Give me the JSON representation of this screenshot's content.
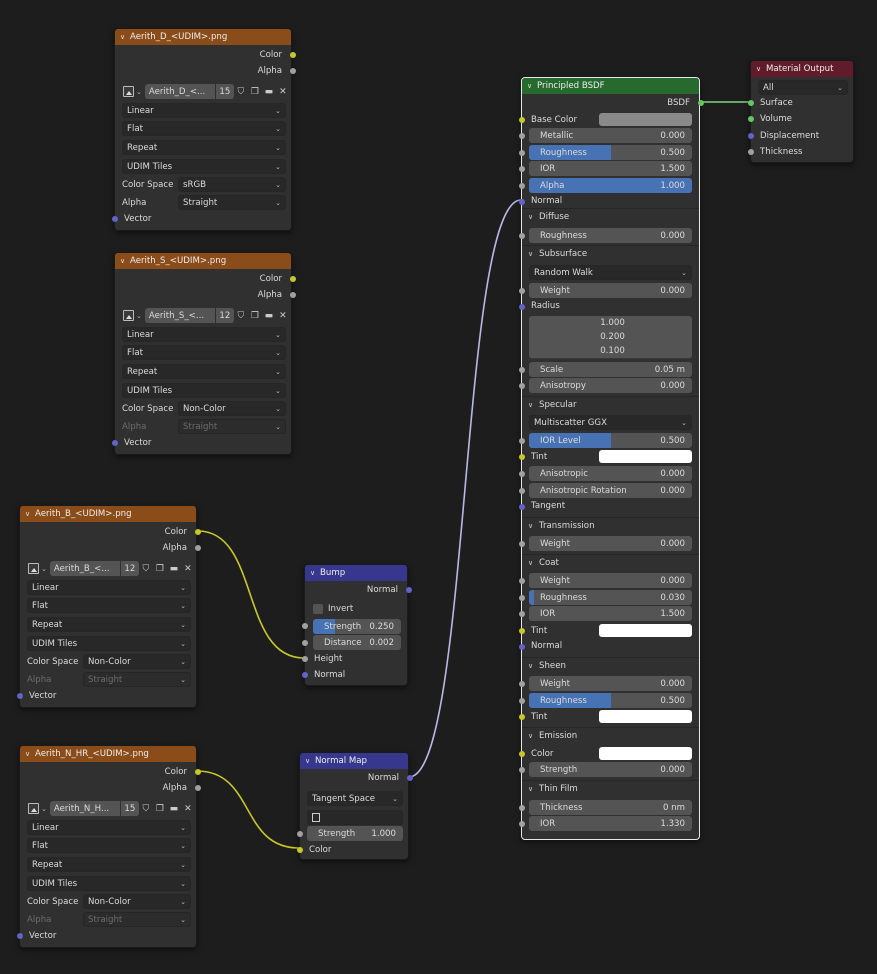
{
  "textures": [
    {
      "title": "Aerith_D_<UDIM>.png",
      "color": "Color",
      "alpha": "Alpha",
      "image_name": "Aerith_D_<...",
      "tile_count": "15",
      "interpolation": "Linear",
      "projection": "Flat",
      "extension": "Repeat",
      "source": "UDIM Tiles",
      "color_space_label": "Color Space",
      "color_space": "sRGB",
      "alpha_label": "Alpha",
      "alpha_mode": "Straight",
      "vector": "Vector"
    },
    {
      "title": "Aerith_S_<UDIM>.png",
      "color": "Color",
      "alpha": "Alpha",
      "image_name": "Aerith_S_<...",
      "tile_count": "12",
      "interpolation": "Linear",
      "projection": "Flat",
      "extension": "Repeat",
      "source": "UDIM Tiles",
      "color_space_label": "Color Space",
      "color_space": "Non-Color",
      "alpha_label": "Alpha",
      "alpha_mode": "Straight",
      "vector": "Vector"
    },
    {
      "title": "Aerith_B_<UDIM>.png",
      "color": "Color",
      "alpha": "Alpha",
      "image_name": "Aerith_B_<...",
      "tile_count": "12",
      "interpolation": "Linear",
      "projection": "Flat",
      "extension": "Repeat",
      "source": "UDIM Tiles",
      "color_space_label": "Color Space",
      "color_space": "Non-Color",
      "alpha_label": "Alpha",
      "alpha_mode": "Straight",
      "vector": "Vector"
    },
    {
      "title": "Aerith_N_HR_<UDIM>.png",
      "color": "Color",
      "alpha": "Alpha",
      "image_name": "Aerith_N_H...",
      "tile_count": "15",
      "interpolation": "Linear",
      "projection": "Flat",
      "extension": "Repeat",
      "source": "UDIM Tiles",
      "color_space_label": "Color Space",
      "color_space": "Non-Color",
      "alpha_label": "Alpha",
      "alpha_mode": "Straight",
      "vector": "Vector"
    }
  ],
  "bump": {
    "title": "Bump",
    "normal_out": "Normal",
    "invert": "Invert",
    "strength_label": "Strength",
    "strength": "0.250",
    "strength_fill": 0.25,
    "distance_label": "Distance",
    "distance": "0.002",
    "height": "Height",
    "normal_in": "Normal"
  },
  "normal_map": {
    "title": "Normal Map",
    "normal_out": "Normal",
    "space": "Tangent Space",
    "strength_label": "Strength",
    "strength": "1.000",
    "color": "Color"
  },
  "bsdf": {
    "title": "Principled BSDF",
    "bsdf_out": "BSDF",
    "base_color": "Base Color",
    "base_color_value": "#8a8a8a",
    "metallic_label": "Metallic",
    "metallic": "0.000",
    "roughness_label": "Roughness",
    "roughness": "0.500",
    "roughness_fill": 0.5,
    "ior_label": "IOR",
    "ior": "1.500",
    "alpha_label": "Alpha",
    "alpha": "1.000",
    "alpha_fill": 1.0,
    "normal": "Normal",
    "diffuse": "Diffuse",
    "diffuse_roughness_label": "Roughness",
    "diffuse_roughness": "0.000",
    "subsurface": "Subsurface",
    "subsurface_method": "Random Walk",
    "ss_weight_label": "Weight",
    "ss_weight": "0.000",
    "radius": "Radius",
    "radius_values": [
      "1.000",
      "0.200",
      "0.100"
    ],
    "scale_label": "Scale",
    "scale": "0.05 m",
    "anisotropy_label": "Anisotropy",
    "anisotropy": "0.000",
    "specular": "Specular",
    "distribution": "Multiscatter GGX",
    "ior_level_label": "IOR Level",
    "ior_level": "0.500",
    "ior_level_fill": 0.5,
    "tint": "Tint",
    "anisotropic_label": "Anisotropic",
    "anisotropic": "0.000",
    "aniso_rot_label": "Anisotropic Rotation",
    "aniso_rot": "0.000",
    "tangent": "Tangent",
    "transmission": "Transmission",
    "trans_weight_label": "Weight",
    "trans_weight": "0.000",
    "coat": "Coat",
    "coat_weight_label": "Weight",
    "coat_weight": "0.000",
    "coat_rough_label": "Roughness",
    "coat_rough": "0.030",
    "coat_rough_fill": 0.03,
    "coat_ior_label": "IOR",
    "coat_ior": "1.500",
    "coat_tint": "Tint",
    "coat_normal": "Normal",
    "sheen": "Sheen",
    "sheen_weight_label": "Weight",
    "sheen_weight": "0.000",
    "sheen_rough_label": "Roughness",
    "sheen_rough": "0.500",
    "sheen_rough_fill": 0.5,
    "sheen_tint": "Tint",
    "emission": "Emission",
    "emission_color": "Color",
    "emission_strength_label": "Strength",
    "emission_strength": "0.000",
    "thin_film": "Thin Film",
    "thickness_label": "Thickness",
    "thickness": "0 nm",
    "tf_ior_label": "IOR",
    "tf_ior": "1.330"
  },
  "output": {
    "title": "Material Output",
    "target": "All",
    "surface": "Surface",
    "volume": "Volume",
    "displacement": "Displacement",
    "thickness": "Thickness"
  },
  "colors": {
    "texture_header": "#8a4c18",
    "vector_header": "#37378d",
    "shader_header": "#266a2e",
    "output_header": "#611c2c",
    "color_socket": "#c7c729",
    "float_socket": "#a1a1a1",
    "vector_socket": "#6363c7",
    "slider_fill": "#4772b3"
  }
}
